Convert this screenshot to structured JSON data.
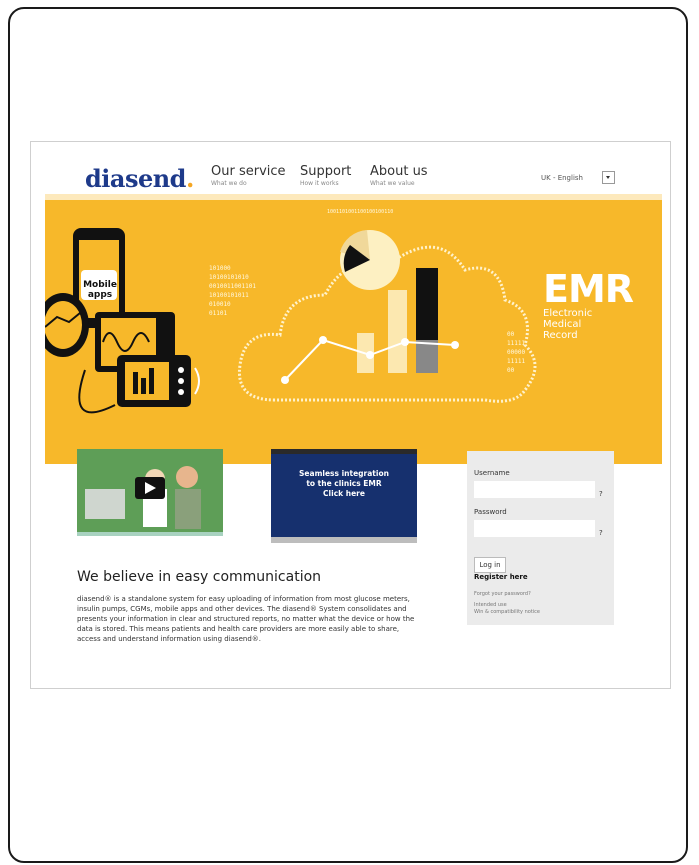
{
  "logo": "diasend",
  "logo_mark": ".",
  "nav": [
    {
      "title": "Our service",
      "sub": "What we do"
    },
    {
      "title": "Support",
      "sub": "How it works"
    },
    {
      "title": "About us",
      "sub": "What we value"
    }
  ],
  "language": "UK - English",
  "banner": {
    "emr_big": "EMR",
    "emr_line1": "Electronic",
    "emr_line2": "Medical",
    "emr_line3": "Record",
    "mobile_line1": "Mobile",
    "mobile_line2": "apps",
    "binary_left": [
      "101000",
      "10100101010",
      "0010011001101",
      "10100101011",
      "010010",
      "01101"
    ],
    "binary_right": [
      "00",
      "11111",
      "00000",
      "11111",
      "00"
    ],
    "cloud_top": "1001101001100100100110"
  },
  "tile2_text": [
    "Seamless integration",
    "to the clinics EMR",
    "Click here"
  ],
  "login": {
    "username_label": "Username",
    "password_label": "Password",
    "help": "?",
    "login_button": "Log in",
    "register": "Register here",
    "forgot": "Forgot your password?",
    "intended": "Intended use",
    "compat": "Win & compatibility notice"
  },
  "headline": "We believe in easy communication",
  "paragraph": "diasend® is a standalone system for easy uploading of information from most glucose meters, insulin pumps, CGMs, mobile apps and other devices. The diasend® System consolidates and presents your information in clear and structured reports, no matter what the device or how the data is stored. This means patients and health care providers are more easily able to share, access and understand information using diasend®.",
  "colors": {
    "banner": "#f7b82a",
    "logo": "#1e3a8a",
    "tile_green": "#5e9e57",
    "tile_blue": "#16306e"
  }
}
